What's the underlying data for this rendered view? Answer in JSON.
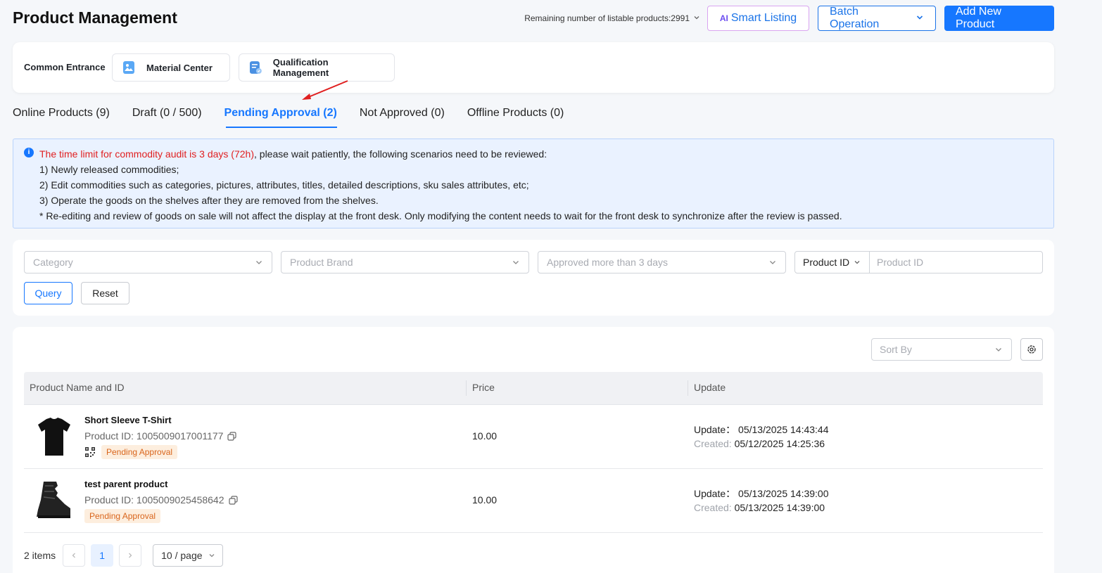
{
  "header": {
    "title": "Product Management",
    "remaining": "Remaining number of listable products:2991",
    "smart_listing": "Smart Listing",
    "smart_ai_glyph": "AI",
    "batch_operation": "Batch Operation",
    "add_new_product": "Add New Product"
  },
  "common_entrance": {
    "label": "Common Entrance",
    "material_center": "Material Center",
    "qualification_management": "Qualification Management"
  },
  "tabs": [
    {
      "label": "Online Products (9)"
    },
    {
      "label": "Draft (0 / 500)"
    },
    {
      "label": "Pending Approval (2)",
      "active": true
    },
    {
      "label": "Not Approved (0)"
    },
    {
      "label": "Offline Products (0)"
    }
  ],
  "notice": {
    "highlight": "The time limit for commodity audit is 3 days (72h)",
    "rest": ", please wait patiently, the following scenarios need to be reviewed:",
    "line1": "1) Newly released commodities;",
    "line2": "2) Edit commodities such as categories, pictures, attributes, titles, detailed descriptions, sku sales attributes, etc;",
    "line3": "3) Operate the goods on the shelves after they are removed from the shelves.",
    "line4": "* Re-editing and review of goods on sale will not affect the display at the front desk. Only modifying the content needs to wait for the front desk to synchronize after the review is passed."
  },
  "filters": {
    "category_placeholder": "Category",
    "brand_placeholder": "Product Brand",
    "approval_placeholder": "Approved more than 3 days",
    "id_type": "Product ID",
    "id_placeholder": "Product ID",
    "query": "Query",
    "reset": "Reset"
  },
  "table": {
    "sort_placeholder": "Sort By",
    "columns": {
      "name": "Product Name and ID",
      "price": "Price",
      "update": "Update"
    },
    "rows": [
      {
        "name": "Short Sleeve T-Shirt",
        "product_id": "Product ID: 1005009017001177",
        "status": "Pending Approval",
        "price": "10.00",
        "update_label": "Update：",
        "update_value": "05/13/2025 14:43:44",
        "created_label": "Created:",
        "created_value": "05/12/2025 14:25:36"
      },
      {
        "name": "test parent product",
        "product_id": "Product ID: 1005009025458642",
        "status": "Pending Approval",
        "price": "10.00",
        "update_label": "Update：",
        "update_value": "05/13/2025 14:39:00",
        "created_label": "Created:",
        "created_value": "05/13/2025 14:39:00"
      }
    ]
  },
  "pagination": {
    "total": "2 items",
    "current": "1",
    "per_page": "10 / page"
  },
  "colors": {
    "primary": "#1677ff",
    "notice_bg": "#eaf2ff",
    "notice_highlight": "#e02020",
    "badge_bg": "#fdeede",
    "badge_text": "#d9651c"
  }
}
